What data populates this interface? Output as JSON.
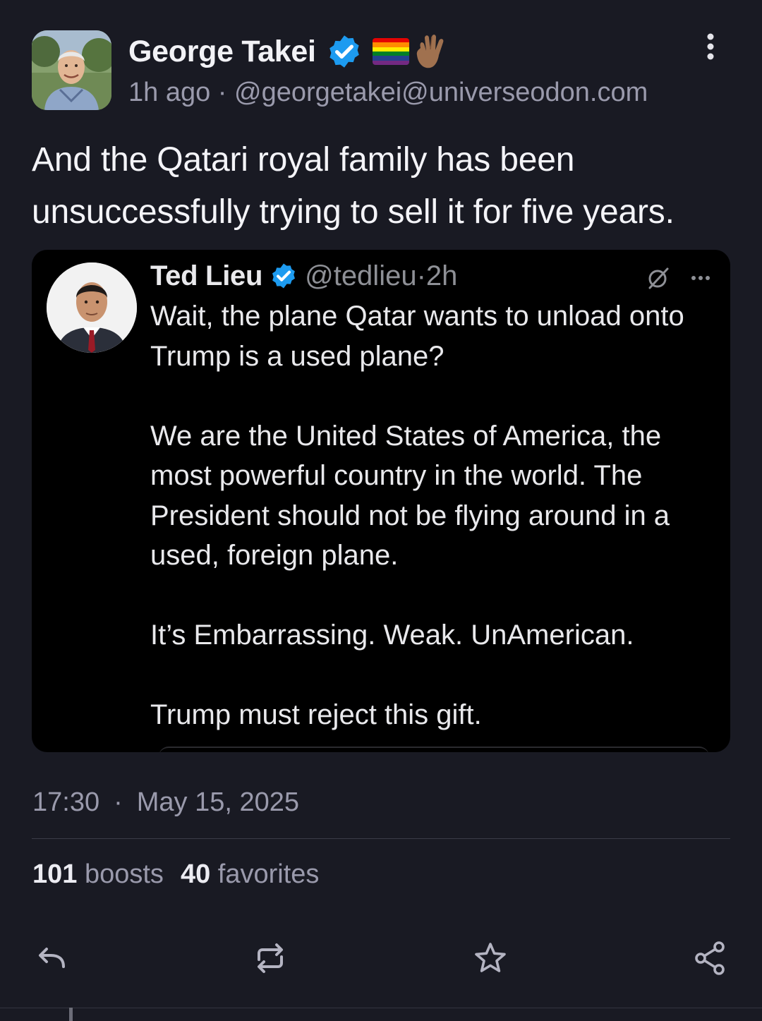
{
  "author": {
    "display_name": "George Takei",
    "time_ago": "1h ago",
    "separator": "·",
    "handle": "@georgetakei@universeodon.com"
  },
  "post": {
    "text": "And the Qatari royal family has been unsuccessfully trying to sell it for five years."
  },
  "embedded_tweet": {
    "name": "Ted Lieu",
    "handle_time": "@tedlieu·2h",
    "paragraphs": [
      "Wait, the plane Qatar wants to unload onto Trump is a used plane?",
      "We are the United States of America, the most powerful country in the world. The President should not be flying around in a used, foreign plane.",
      "It’s Embarrassing. Weak. UnAmerican.",
      "Trump must reject this gift."
    ]
  },
  "footer": {
    "time": "17:30",
    "dot": "·",
    "date": "May 15, 2025",
    "boosts_count": "101",
    "boosts_label": "boosts",
    "favorites_count": "40",
    "favorites_label": "favorites"
  },
  "icons": {
    "verified": "verified-badge-icon",
    "flag": "rainbow-flag-icon",
    "hand": "vulcan-salute-icon",
    "menu": "more-vertical-icon",
    "reply": "reply-icon",
    "boost": "boost-icon",
    "favorite": "star-icon",
    "share": "share-icon"
  },
  "colors": {
    "background": "#191a23",
    "verified_blue": "#1d9bf0",
    "muted_text": "#9a9aac"
  }
}
